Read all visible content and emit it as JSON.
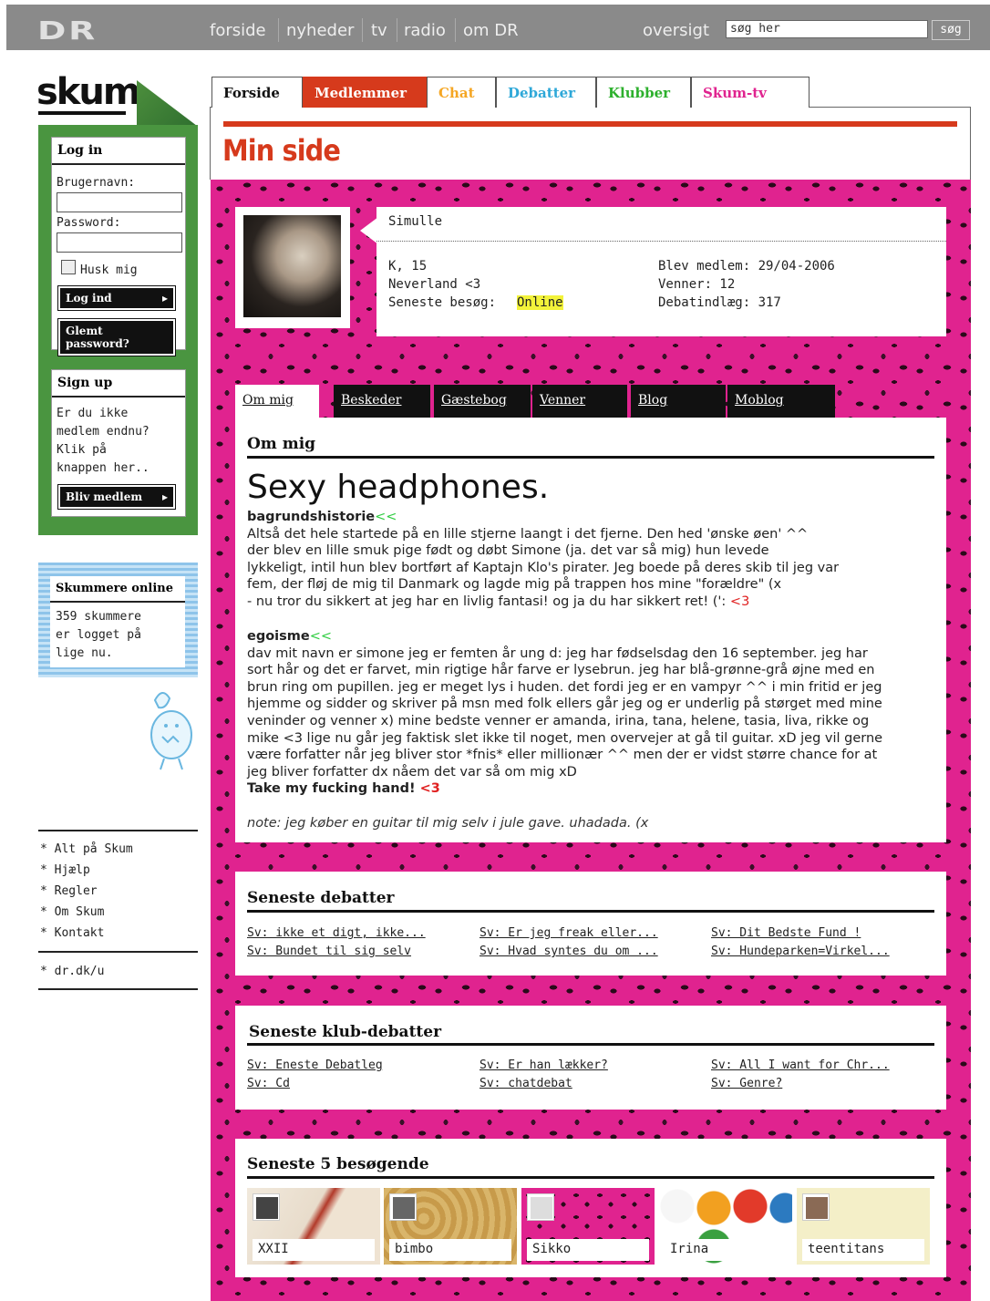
{
  "topbar": {
    "logo": "DR",
    "nav": [
      "forside",
      "nyheder",
      "tv",
      "radio",
      "om DR"
    ],
    "overview": "oversigt",
    "search_placeholder": "søg her",
    "search_button": "søg"
  },
  "sidebar": {
    "logo": "skum",
    "login": {
      "title": "Log in",
      "username_label": "Brugernavn:",
      "password_label": "Password:",
      "remember_label": "Husk mig",
      "login_button": "Log ind",
      "forgot_button": "Glemt password?"
    },
    "signup": {
      "title": "Sign up",
      "text": [
        "Er du ikke",
        "medlem endnu?",
        "Klik på",
        "knappen her.."
      ],
      "button": "Bliv medlem"
    },
    "online": {
      "title": "Skummere online",
      "text": [
        "359 skummere",
        "er logget på",
        "lige nu."
      ]
    },
    "links": [
      "* Alt på Skum",
      "* Hjælp",
      "* Regler",
      "* Om Skum",
      "* Kontakt"
    ],
    "extra_link": "* dr.dk/u"
  },
  "tabs": [
    {
      "label": "Forside",
      "color": "#111111"
    },
    {
      "label": "Medlemmer",
      "color": "#ffffff"
    },
    {
      "label": "Chat",
      "color": "#f5a623"
    },
    {
      "label": "Debatter",
      "color": "#2ea8d8"
    },
    {
      "label": "Klubber",
      "color": "#2db02d"
    },
    {
      "label": "Skum-tv",
      "color": "#e0238f"
    }
  ],
  "page_title": "Min side",
  "profile": {
    "name": "Simulle",
    "line1": "K, 15",
    "line2": "Neverland <3",
    "last_visit_label": "Seneste besøg:",
    "last_visit_value": "Online",
    "member_since": "Blev medlem: 29/04-2006",
    "friends": "Venner: 12",
    "posts": "Debatindlæg: 317"
  },
  "subtabs": [
    "Om mig",
    "Beskeder",
    "Gæstebog",
    "Venner",
    "Blog",
    "Moblog"
  ],
  "about": {
    "heading": "Om mig",
    "title": "Sexy headphones.",
    "sec1_title": "bagrundshistorie",
    "sec1_arrows": "<<",
    "sec1_lines": [
      "Altså det hele startede på en lille stjerne laangt i det fjerne. Den hed 'ønske øen' ^^",
      "der blev en lille smuk pige født og døbt Simone (ja. det var så mig) hun levede",
      "lykkeligt, intil hun blev bortført af Kaptajn Klo's pirater. Jeg boede på deres skib til jeg var",
      "fem, der fløj de mig til Danmark og lagde mig på trappen hos mine \"forældre\" (x",
      "- nu tror du sikkert at jeg har en livlig fantasi! og ja du har sikkert ret! (': "
    ],
    "sec1_heart": "<3",
    "sec2_title": "egoisme",
    "sec2_arrows": "<<",
    "sec2_lines": [
      "dav mit navn er simone jeg er femten år ung d: jeg har fødselsdag den 16 september. jeg har",
      "sort hår og det er farvet, min rigtige hår farve er lysebrun. jeg har blå-grønne-grå øjne med en",
      "brun ring om pupillen. jeg er meget lys i huden. det fordi jeg er en vampyr ^^ i min fritid er jeg",
      "hjemme og sidder og skriver på msn med folk ellers går jeg og er underlig på størget med mine",
      "veninder og venner x) mine bedste venner er amanda, irina, tana, helene, tasia, liva, rikke og",
      "mike <3 lige nu går jeg faktisk slet ikke til noget, men overvejer at gå til guitar. xD jeg vil gerne",
      "være forfatter når jeg bliver stor *fnis* eller millionær ^^ men der er vidst større chance for at",
      "jeg bliver forfatter dx nåem det var så om mig xD"
    ],
    "take_hand": "Take my fucking hand! ",
    "take_heart": "<3",
    "note": "note: jeg køber en guitar til mig selv i jule gave. uhadada. (x"
  },
  "debates": {
    "title": "Seneste debatter",
    "links": [
      "Sv: ikke et digt, ikke...",
      "Sv: Er jeg freak eller...",
      "Sv: Dit Bedste Fund !",
      "Sv: Bundet til sig selv",
      "Sv: Hvad syntes du om ...",
      "Sv: Hundeparken=Virkel..."
    ]
  },
  "club_debates": {
    "title": "Seneste klub-debatter",
    "links": [
      "Sv: Eneste Debatleg",
      "Sv: Er han lækker?",
      "Sv: All I want for Chr...",
      "Sv: Cd",
      "Sv: chatdebat",
      "Sv: Genre?"
    ]
  },
  "visitors": {
    "title": "Seneste 5 besøgende",
    "names": [
      "XXII",
      "bimbo",
      "Sikko",
      "Irina",
      "teentitans"
    ]
  }
}
